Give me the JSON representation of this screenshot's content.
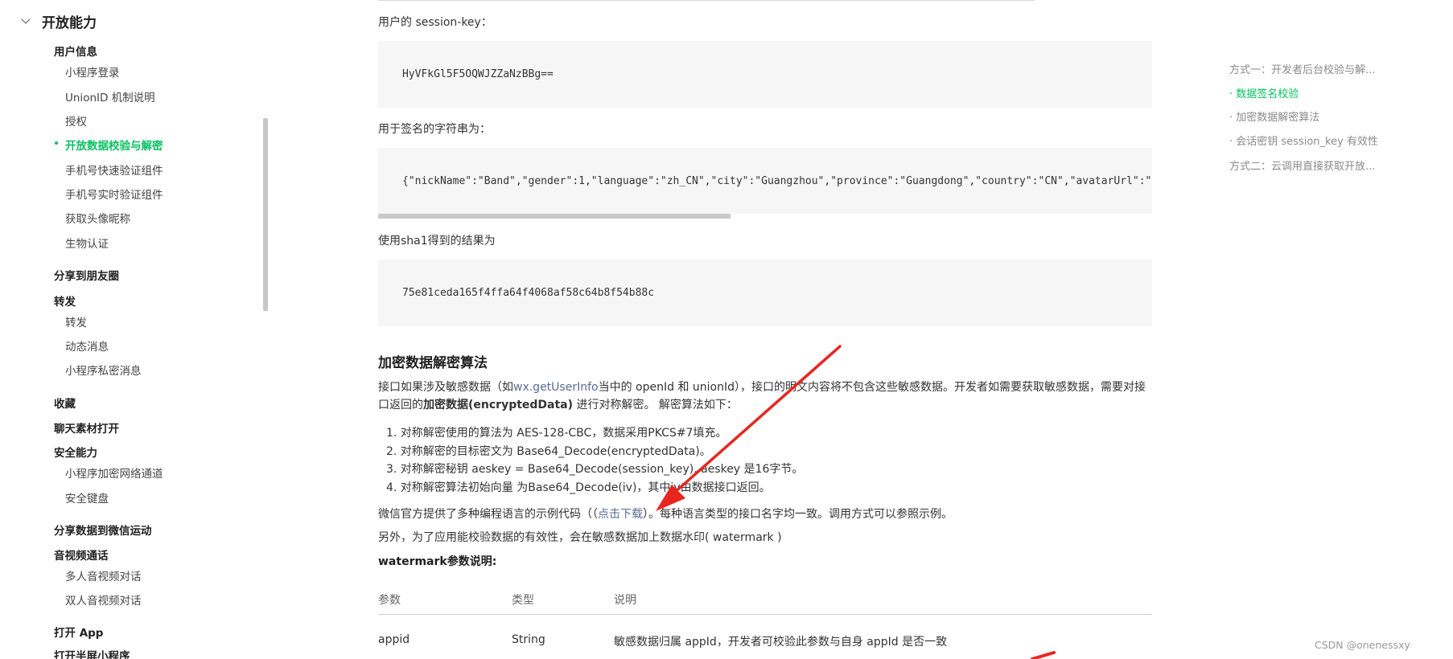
{
  "sidebar": {
    "group_label": "开放能力",
    "items": [
      {
        "label": "用户信息",
        "kind": "section"
      },
      {
        "label": "小程序登录",
        "kind": "sub"
      },
      {
        "label": "UnionID 机制说明",
        "kind": "sub"
      },
      {
        "label": "授权",
        "kind": "sub"
      },
      {
        "label": "开放数据校验与解密",
        "kind": "sub",
        "active": true
      },
      {
        "label": "手机号快速验证组件",
        "kind": "sub"
      },
      {
        "label": "手机号实时验证组件",
        "kind": "sub"
      },
      {
        "label": "获取头像昵称",
        "kind": "sub"
      },
      {
        "label": "生物认证",
        "kind": "sub"
      },
      {
        "label": "分享到朋友圈",
        "kind": "section"
      },
      {
        "label": "转发",
        "kind": "section"
      },
      {
        "label": "转发",
        "kind": "sub"
      },
      {
        "label": "动态消息",
        "kind": "sub"
      },
      {
        "label": "小程序私密消息",
        "kind": "sub"
      },
      {
        "label": "收藏",
        "kind": "section"
      },
      {
        "label": "聊天素材打开",
        "kind": "section"
      },
      {
        "label": "安全能力",
        "kind": "section"
      },
      {
        "label": "小程序加密网络通道",
        "kind": "sub"
      },
      {
        "label": "安全键盘",
        "kind": "sub"
      },
      {
        "label": "分享数据到微信运动",
        "kind": "section"
      },
      {
        "label": "音视频通话",
        "kind": "section"
      },
      {
        "label": "多人音视频对话",
        "kind": "sub"
      },
      {
        "label": "双人音视频对话",
        "kind": "sub"
      },
      {
        "label": "打开 App",
        "kind": "section"
      },
      {
        "label": "打开半屏小程序",
        "kind": "section"
      }
    ]
  },
  "content": {
    "session_key_label": "用户的 session-key：",
    "session_key_value": "HyVFkGl5F5OQWJZZaNzBBg==",
    "sign_string_label": "用于签名的字符串为：",
    "sign_string_value": "{\"nickName\":\"Band\",\"gender\":1,\"language\":\"zh_CN\",\"city\":\"Guangzhou\",\"province\":\"Guangdong\",\"country\":\"CN\",\"avatarUrl\":\"ht",
    "sha1_label": "使用sha1得到的结果为",
    "sha1_value": "75e81ceda165f4ffa64f4068af58c64b8f54b88c",
    "section_title": "加密数据解密算法",
    "intro_pre": "接口如果涉及敏感数据（如",
    "intro_link": "wx.getUserInfo",
    "intro_mid": "当中的 openId 和 unionId），接口的明文内容将不包含这些敏感数据。开发者如需要获取敏感数据，需要对接口返回的",
    "intro_bold": "加密数据(encryptedData)",
    "intro_post": " 进行对称解密。 解密算法如下：",
    "steps": [
      "1. 对称解密使用的算法为 AES-128-CBC，数据采用PKCS#7填充。",
      "2. 对称解密的目标密文为 Base64_Decode(encryptedData)。",
      "3. 对称解密秘钥 aeskey = Base64_Decode(session_key), aeskey 是16字节。",
      "4. 对称解密算法初始向量 为Base64_Decode(iv)，其中iv由数据接口返回。"
    ],
    "sample_pre": "微信官方提供了多种编程语言的示例代码（（",
    "sample_link": "点击下载",
    "sample_post": "）。每种语言类型的接口名字均一致。调用方式可以参照示例。",
    "watermark_note": "另外，为了应用能校验数据的有效性，会在敏感数据加上数据水印( watermark )",
    "watermark_title": "watermark参数说明:",
    "table": {
      "headers": [
        "参数",
        "类型",
        "说明"
      ],
      "rows": [
        [
          "appid",
          "String",
          "敏感数据归属 appId，开发者可校验此参数与自身 appId 是否一致"
        ]
      ]
    }
  },
  "toc": {
    "items": [
      {
        "label": "方式一：开发者后台校验与解..."
      },
      {
        "label": "· 数据签名校验",
        "active": true
      },
      {
        "label": "· 加密数据解密算法"
      },
      {
        "label": "· 会话密钥 session_key 有效性"
      },
      {
        "label": "方式二：云调用直接获取开放..."
      }
    ]
  },
  "footer": {
    "watermark": "CSDN @onenessxy"
  },
  "colors": {
    "accent": "#07c160",
    "link": "#576b95",
    "annotation": "#e8261f"
  }
}
